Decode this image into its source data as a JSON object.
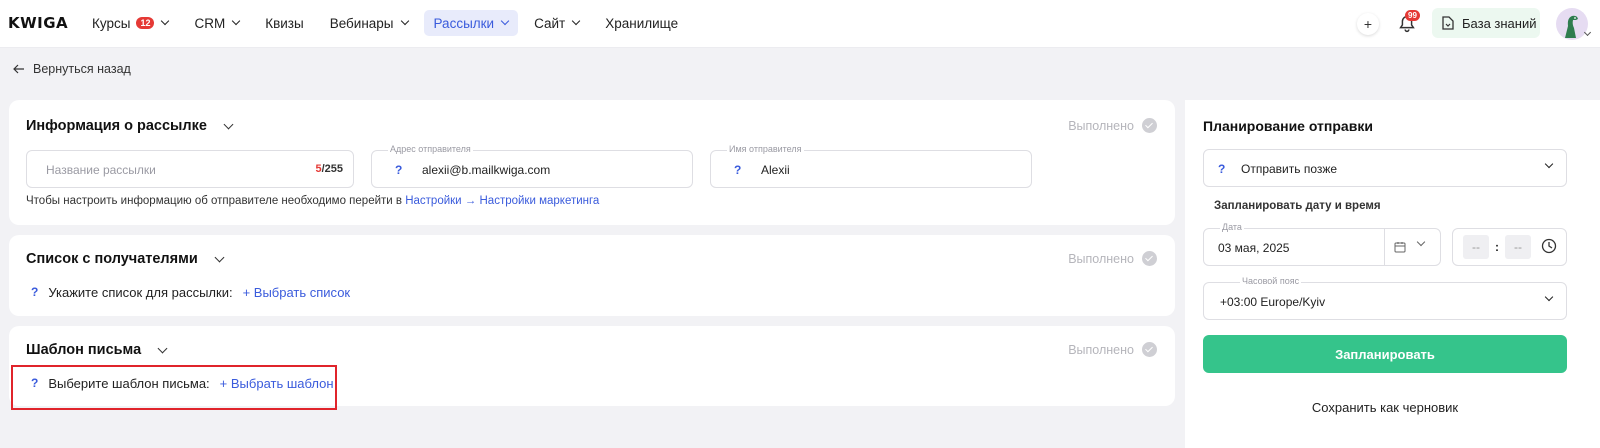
{
  "app": {
    "logo": "KWIGA"
  },
  "nav": {
    "items": [
      {
        "label": "Курсы",
        "badge": "12",
        "has_dropdown": true,
        "active": false
      },
      {
        "label": "CRM",
        "has_dropdown": true,
        "active": false
      },
      {
        "label": "Квизы",
        "has_dropdown": false,
        "active": false
      },
      {
        "label": "Вебинары",
        "has_dropdown": true,
        "active": false
      },
      {
        "label": "Рассылки",
        "has_dropdown": true,
        "active": true
      },
      {
        "label": "Сайт",
        "has_dropdown": true,
        "active": false
      },
      {
        "label": "Хранилище",
        "has_dropdown": false,
        "active": false
      }
    ],
    "notifications_badge": "99",
    "knowledge_base_label": "База знаний"
  },
  "back": {
    "label": "Вернуться назад"
  },
  "mailing_info": {
    "title": "Информация о рассылке",
    "status": "Выполнено",
    "name_placeholder": "Название рассылки",
    "name_counter_current": "5",
    "name_counter_max": "/255",
    "sender_address_label": "Адрес отправителя",
    "sender_address_value": "alexii@b.mailkwiga.com",
    "sender_name_label": "Имя отправителя",
    "sender_name_value": "Alexii",
    "hint_text": "Чтобы настроить информацию об отправителе необходимо перейти в",
    "hint_link": "Настройки → Настройки маркетинга"
  },
  "recipients": {
    "title": "Список с получателями",
    "status": "Выполнено",
    "prompt": "Укажите список для рассылки:",
    "action": "+ Выбрать список"
  },
  "template": {
    "title": "Шаблон письма",
    "status": "Выполнено",
    "prompt": "Выберите шаблон письма:",
    "action": "+ Выбрать шаблон"
  },
  "schedule": {
    "title": "Планирование отправки",
    "send_mode": "Отправить позже",
    "datetime_label": "Запланировать дату и время",
    "date_label": "Дата",
    "date_value": "03 мая, 2025",
    "hours": "--",
    "minutes": "--",
    "time_separator": ":",
    "timezone_label": "Часовой пояс",
    "timezone_value": "+03:00 Europe/Kyiv",
    "schedule_button": "Запланировать",
    "draft_button": "Сохранить как черновик"
  },
  "colors": {
    "accent": "#3a5bdc",
    "success": "#35c48b",
    "highlight": "#e0242b"
  }
}
